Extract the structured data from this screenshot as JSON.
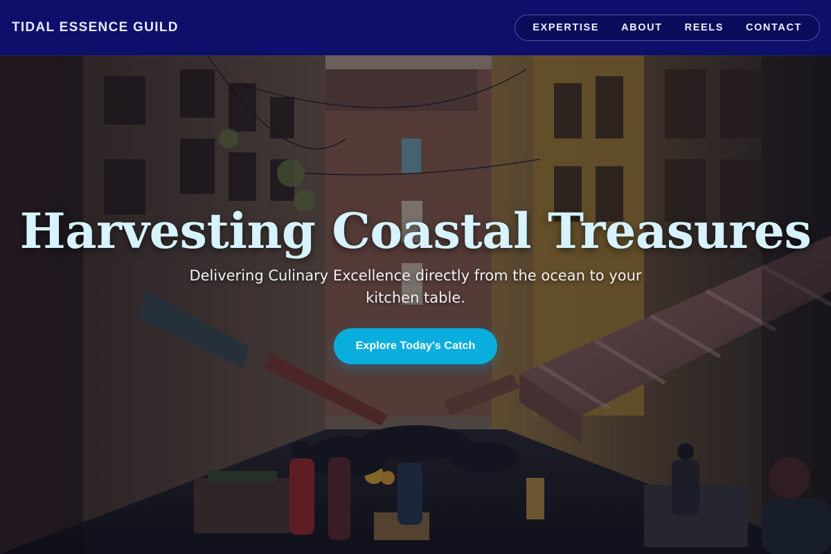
{
  "brand": {
    "name": "TIDAL ESSENCE GUILD"
  },
  "nav": {
    "items": [
      {
        "label": "EXPERTISE"
      },
      {
        "label": "ABOUT"
      },
      {
        "label": "REELS"
      },
      {
        "label": "CONTACT"
      }
    ]
  },
  "hero": {
    "headline": "Harvesting Coastal Treasures",
    "subheadline": "Delivering Culinary Excellence directly from the ocean to your kitchen table.",
    "cta_label": "Explore Today's Catch",
    "background": "photo of a narrow old-town street market with awnings, balconies and shoppers"
  },
  "colors": {
    "navbar_bg": "#0e0f6b",
    "headline": "#d6f3ff",
    "cta_bg": "#0aaedc",
    "cta_text": "#ffffff"
  }
}
